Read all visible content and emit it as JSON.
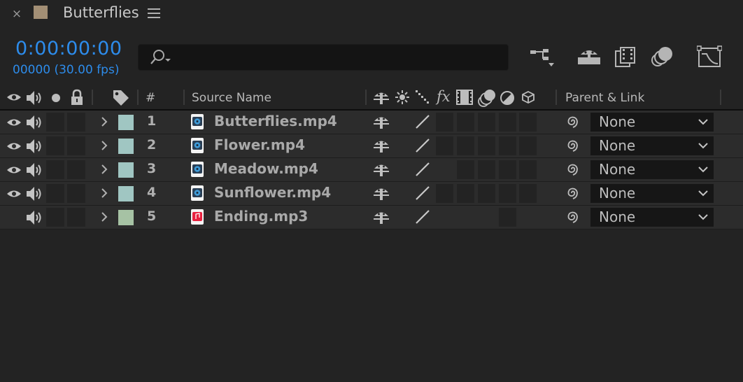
{
  "tab": {
    "title": "Butterflies",
    "close_glyph": "×",
    "swatch_color": "#a38f75"
  },
  "time": {
    "timecode": "0:00:00:00",
    "frames": "00000 (30.00 fps)",
    "accent_color": "#2d8ceb"
  },
  "search": {
    "value": "",
    "icon": "search-icon"
  },
  "toolbar": {
    "icons": [
      "composition-mini-flowchart-icon",
      "draft-3d-shy-icon",
      "frame-blending-icon",
      "motion-blur-icon",
      "graph-editor-icon"
    ]
  },
  "columns": {
    "number": "#",
    "source_name": "Source Name",
    "parent_link": "Parent & Link",
    "fx": "fx"
  },
  "layers": [
    {
      "index": "1",
      "name": "Butterflies.mp4",
      "type": "video",
      "label_color": "#a0c6c2",
      "video": true,
      "audio": true,
      "parent": "None"
    },
    {
      "index": "2",
      "name": "Flower.mp4",
      "type": "video",
      "label_color": "#a0c6c2",
      "video": true,
      "audio": true,
      "parent": "None"
    },
    {
      "index": "3",
      "name": "Meadow.mp4",
      "type": "video",
      "label_color": "#a0c6c2",
      "video": true,
      "audio": true,
      "parent": "None"
    },
    {
      "index": "4",
      "name": "Sunflower.mp4",
      "type": "video",
      "label_color": "#a0c6c2",
      "video": true,
      "audio": true,
      "parent": "None"
    },
    {
      "index": "5",
      "name": "Ending.mp3",
      "type": "audio",
      "label_color": "#a6c2a4",
      "video": false,
      "audio": true,
      "parent": "None"
    }
  ]
}
